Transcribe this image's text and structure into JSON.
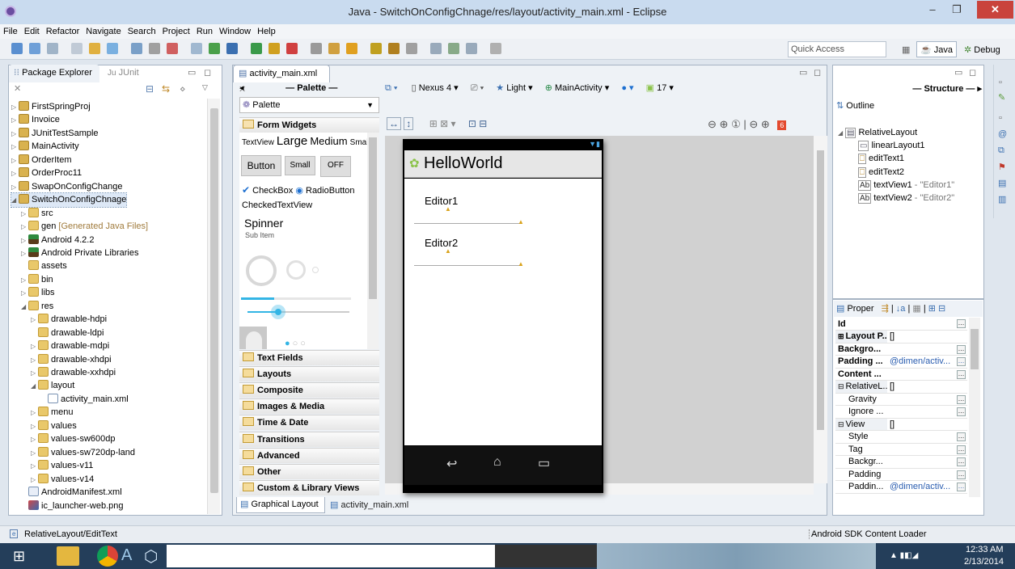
{
  "window": {
    "title": "Java - SwitchOnConfigChnage/res/layout/activity_main.xml - Eclipse"
  },
  "menu": [
    "File",
    "Edit",
    "Refactor",
    "Navigate",
    "Search",
    "Project",
    "Run",
    "Window",
    "Help"
  ],
  "toolbar": {
    "quick_access_placeholder": "Quick Access",
    "perspective_java": "Java",
    "perspective_debug": "Debug"
  },
  "package_explorer": {
    "tab_label": "Package Explorer",
    "tab2_label": "JUnit",
    "items": [
      {
        "label": "FirstSpringProj",
        "level": 0,
        "expander": "closed",
        "icon": "project"
      },
      {
        "label": "Invoice",
        "level": 0,
        "expander": "closed",
        "icon": "project"
      },
      {
        "label": "JUnitTestSample",
        "level": 0,
        "expander": "closed",
        "icon": "project"
      },
      {
        "label": "MainActivity",
        "level": 0,
        "expander": "closed",
        "icon": "project"
      },
      {
        "label": "OrderItem",
        "level": 0,
        "expander": "closed",
        "icon": "project"
      },
      {
        "label": "OrderProc11",
        "level": 0,
        "expander": "closed",
        "icon": "project"
      },
      {
        "label": "SwapOnConfigChange",
        "level": 0,
        "expander": "closed",
        "icon": "project"
      },
      {
        "label": "SwitchOnConfigChnage",
        "level": 0,
        "expander": "open",
        "icon": "project",
        "selected": true
      },
      {
        "label": "src",
        "level": 1,
        "expander": "closed",
        "icon": "package-folder"
      },
      {
        "label": "gen",
        "suffix": " [Generated Java Files]",
        "level": 1,
        "expander": "closed",
        "icon": "package-folder"
      },
      {
        "label": "Android 4.2.2",
        "level": 1,
        "expander": "closed",
        "icon": "library"
      },
      {
        "label": "Android Private Libraries",
        "level": 1,
        "expander": "closed",
        "icon": "library"
      },
      {
        "label": "assets",
        "level": 1,
        "expander": "none",
        "icon": "folder"
      },
      {
        "label": "bin",
        "level": 1,
        "expander": "closed",
        "icon": "folder"
      },
      {
        "label": "libs",
        "level": 1,
        "expander": "closed",
        "icon": "folder"
      },
      {
        "label": "res",
        "level": 1,
        "expander": "open",
        "icon": "folder"
      },
      {
        "label": "drawable-hdpi",
        "level": 2,
        "expander": "closed",
        "icon": "folder"
      },
      {
        "label": "drawable-ldpi",
        "level": 2,
        "expander": "none",
        "icon": "folder"
      },
      {
        "label": "drawable-mdpi",
        "level": 2,
        "expander": "closed",
        "icon": "folder"
      },
      {
        "label": "drawable-xhdpi",
        "level": 2,
        "expander": "closed",
        "icon": "folder"
      },
      {
        "label": "drawable-xxhdpi",
        "level": 2,
        "expander": "closed",
        "icon": "folder"
      },
      {
        "label": "layout",
        "level": 2,
        "expander": "open",
        "icon": "folder"
      },
      {
        "label": "activity_main.xml",
        "level": 3,
        "expander": "none",
        "icon": "xml-file"
      },
      {
        "label": "menu",
        "level": 2,
        "expander": "closed",
        "icon": "folder"
      },
      {
        "label": "values",
        "level": 2,
        "expander": "closed",
        "icon": "folder"
      },
      {
        "label": "values-sw600dp",
        "level": 2,
        "expander": "closed",
        "icon": "folder"
      },
      {
        "label": "values-sw720dp-land",
        "level": 2,
        "expander": "closed",
        "icon": "folder"
      },
      {
        "label": "values-v11",
        "level": 2,
        "expander": "closed",
        "icon": "folder"
      },
      {
        "label": "values-v14",
        "level": 2,
        "expander": "closed",
        "icon": "folder"
      },
      {
        "label": "AndroidManifest.xml",
        "level": 1,
        "expander": "none",
        "icon": "manifest-file"
      },
      {
        "label": "ic_launcher-web.png",
        "level": 1,
        "expander": "none",
        "icon": "image-file"
      }
    ]
  },
  "editor": {
    "tab_label": "activity_main.xml",
    "bottom_tabs": [
      {
        "label": "Graphical Layout",
        "active": true
      },
      {
        "label": "activity_main.xml",
        "active": false
      }
    ]
  },
  "palette": {
    "header": "Palette",
    "dropdown_label": "Palette",
    "form_widgets": "Form Widgets",
    "textview_row": [
      "TextView",
      "Large",
      "Medium",
      "Small"
    ],
    "buttons": [
      "Button",
      "Small",
      "OFF"
    ],
    "checkbox_label": "CheckBox",
    "radio_label": "RadioButton",
    "checked_textview": "CheckedTextView",
    "spinner_label": "Spinner",
    "spinner_sub": "Sub Item",
    "seekbar_level": 0.3,
    "categories": [
      "Text Fields",
      "Layouts",
      "Composite",
      "Images & Media",
      "Time & Date",
      "Transitions",
      "Advanced",
      "Other",
      "Custom & Library Views"
    ]
  },
  "device_toolbar": {
    "device": "Nexus 4",
    "theme": "Light",
    "activity": "MainActivity",
    "api": "17"
  },
  "preview": {
    "app_title": "HelloWorld",
    "editor1": "Editor1",
    "editor2": "Editor2"
  },
  "structure": {
    "header": "Structure",
    "outline_label": "Outline",
    "items": [
      {
        "label": "RelativeLayout",
        "level": 0,
        "icon": "relative-layout"
      },
      {
        "label": "linearLayout1",
        "level": 1,
        "icon": "linear-layout"
      },
      {
        "label": "editText1",
        "level": 1,
        "icon": "edittext"
      },
      {
        "label": "editText2",
        "level": 1,
        "icon": "edittext"
      },
      {
        "label": "textView1",
        "suffix": " - \"Editor1\"",
        "level": 1,
        "icon": "textview"
      },
      {
        "label": "textView2",
        "suffix": " - \"Editor2\"",
        "level": 1,
        "icon": "textview"
      }
    ]
  },
  "properties": {
    "tab_label": "Proper",
    "rows": [
      {
        "name": "Id",
        "value": "",
        "bold": true,
        "group": false
      },
      {
        "name": "Layout P...",
        "value": "[]",
        "bold": true,
        "group": "plus"
      },
      {
        "name": "Backgro...",
        "value": "",
        "bold": true,
        "group": false
      },
      {
        "name": "Padding ...",
        "value": "@dimen/activ...",
        "bold": true,
        "group": false,
        "blue": true
      },
      {
        "name": "Content ...",
        "value": "",
        "bold": true,
        "group": false
      },
      {
        "name": "RelativeL...",
        "value": "[]",
        "bold": false,
        "group": "minus"
      },
      {
        "name": "Gravity",
        "value": "",
        "bold": false,
        "group": false,
        "indent": true
      },
      {
        "name": "Ignore ...",
        "value": "",
        "bold": false,
        "group": false,
        "indent": true
      },
      {
        "name": "View",
        "value": "[]",
        "bold": false,
        "group": "minus"
      },
      {
        "name": "Style",
        "value": "",
        "bold": false,
        "group": false,
        "indent": true
      },
      {
        "name": "Tag",
        "value": "",
        "bold": false,
        "group": false,
        "indent": true
      },
      {
        "name": "Backgr...",
        "value": "",
        "bold": false,
        "group": false,
        "indent": true
      },
      {
        "name": "Padding",
        "value": "",
        "bold": false,
        "group": false,
        "indent": true
      },
      {
        "name": "Paddin...",
        "value": "@dimen/activ...",
        "bold": false,
        "group": false,
        "indent": true,
        "blue": true
      }
    ]
  },
  "status": {
    "left": "RelativeLayout/EditText",
    "right": "Android SDK Content Loader"
  },
  "taskbar": {
    "time": "12:33 AM",
    "date": "2/13/2014"
  }
}
